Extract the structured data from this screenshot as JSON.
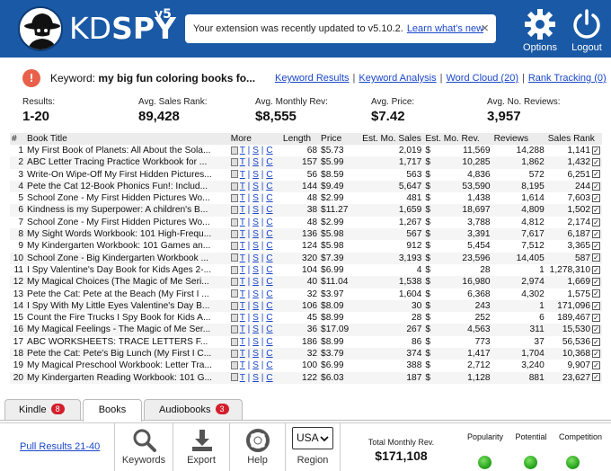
{
  "header": {
    "logo_main": "KD",
    "logo_spy": "SPY",
    "version": "v5",
    "notice_text": "Your extension was recently updated to v5.10.2.",
    "notice_link": "Learn what's new",
    "close_glyph": "×",
    "options_label": "Options",
    "logout_label": "Logout"
  },
  "keyword_bar": {
    "info_glyph": "!",
    "label": "Keyword:",
    "value": "my big fun coloring books fo...",
    "links": [
      "Keyword Results",
      "Keyword Analysis",
      "Word Cloud (20)",
      "Rank Tracking (0)"
    ],
    "separator": "|"
  },
  "stats": [
    {
      "label": "Results:",
      "value": "1-20"
    },
    {
      "label": "Avg. Sales Rank:",
      "value": "89,428"
    },
    {
      "label": "Avg. Monthly Rev:",
      "value": "$8,555"
    },
    {
      "label": "Avg. Price:",
      "value": "$7.42"
    },
    {
      "label": "Avg. No. Reviews:",
      "value": "3,957"
    }
  ],
  "table": {
    "headers": [
      "#",
      "Book Title",
      "More",
      "Length",
      "Price",
      "Est. Mo. Sales",
      "Est. Mo. Rev.",
      "Reviews",
      "Sales Rank"
    ],
    "more_links": [
      "T",
      "S",
      "C"
    ],
    "more_sep": "|",
    "currency": "$",
    "rows": [
      {
        "n": "1",
        "title": "My First Book of Planets: All About the Sola...",
        "length": "68",
        "price": "$5.73",
        "sales": "2,019",
        "rev": "11,569",
        "reviews": "14,288",
        "rank": "1,141"
      },
      {
        "n": "2",
        "title": "ABC Letter Tracing Practice Workbook for ...",
        "length": "157",
        "price": "$5.99",
        "sales": "1,717",
        "rev": "10,285",
        "reviews": "1,862",
        "rank": "1,432"
      },
      {
        "n": "3",
        "title": "Write-On Wipe-Off My First Hidden Pictures...",
        "length": "56",
        "price": "$8.59",
        "sales": "563",
        "rev": "4,836",
        "reviews": "572",
        "rank": "6,251"
      },
      {
        "n": "4",
        "title": "Pete the Cat 12-Book Phonics Fun!: Includ...",
        "length": "144",
        "price": "$9.49",
        "sales": "5,647",
        "rev": "53,590",
        "reviews": "8,195",
        "rank": "244"
      },
      {
        "n": "5",
        "title": "School Zone - My First Hidden Pictures Wo...",
        "length": "48",
        "price": "$2.99",
        "sales": "481",
        "rev": "1,438",
        "reviews": "1,614",
        "rank": "7,603"
      },
      {
        "n": "6",
        "title": "Kindness is my Superpower: A children's B...",
        "length": "38",
        "price": "$11.27",
        "sales": "1,659",
        "rev": "18,697",
        "reviews": "4,809",
        "rank": "1,502"
      },
      {
        "n": "7",
        "title": "School Zone - My First Hidden Pictures Wo...",
        "length": "48",
        "price": "$2.99",
        "sales": "1,267",
        "rev": "3,788",
        "reviews": "4,812",
        "rank": "2,174"
      },
      {
        "n": "8",
        "title": "My Sight Words Workbook: 101 High-Frequ...",
        "length": "136",
        "price": "$5.98",
        "sales": "567",
        "rev": "3,391",
        "reviews": "7,617",
        "rank": "6,187"
      },
      {
        "n": "9",
        "title": "My Kindergarten Workbook: 101 Games an...",
        "length": "124",
        "price": "$5.98",
        "sales": "912",
        "rev": "5,454",
        "reviews": "7,512",
        "rank": "3,365"
      },
      {
        "n": "10",
        "title": "School Zone - Big Kindergarten Workbook ...",
        "length": "320",
        "price": "$7.39",
        "sales": "3,193",
        "rev": "23,596",
        "reviews": "14,405",
        "rank": "587"
      },
      {
        "n": "11",
        "title": "I Spy Valentine's Day Book for Kids Ages 2-...",
        "length": "104",
        "price": "$6.99",
        "sales": "4",
        "rev": "28",
        "reviews": "1",
        "rank": "1,278,310"
      },
      {
        "n": "12",
        "title": "My Magical Choices (The Magic of Me Seri...",
        "length": "40",
        "price": "$11.04",
        "sales": "1,538",
        "rev": "16,980",
        "reviews": "2,974",
        "rank": "1,669"
      },
      {
        "n": "13",
        "title": "Pete the Cat: Pete at the Beach (My First I ...",
        "length": "32",
        "price": "$3.97",
        "sales": "1,604",
        "rev": "6,368",
        "reviews": "4,302",
        "rank": "1,575"
      },
      {
        "n": "14",
        "title": "I Spy With My Little Eyes Valentine's Day B...",
        "length": "106",
        "price": "$8.09",
        "sales": "30",
        "rev": "243",
        "reviews": "1",
        "rank": "171,096"
      },
      {
        "n": "15",
        "title": "Count the Fire Trucks I Spy Book for Kids A...",
        "length": "45",
        "price": "$8.99",
        "sales": "28",
        "rev": "252",
        "reviews": "6",
        "rank": "189,467"
      },
      {
        "n": "16",
        "title": "My Magical Feelings - The Magic of Me Ser...",
        "length": "36",
        "price": "$17.09",
        "sales": "267",
        "rev": "4,563",
        "reviews": "311",
        "rank": "15,530"
      },
      {
        "n": "17",
        "title": "ABC WORKSHEETS: TRACE LETTERS F...",
        "length": "186",
        "price": "$8.99",
        "sales": "86",
        "rev": "773",
        "reviews": "37",
        "rank": "56,536"
      },
      {
        "n": "18",
        "title": "Pete the Cat: Pete's Big Lunch (My First I C...",
        "length": "32",
        "price": "$3.79",
        "sales": "374",
        "rev": "1,417",
        "reviews": "1,704",
        "rank": "10,368"
      },
      {
        "n": "19",
        "title": "My Magical Preschool Workbook: Letter Tra...",
        "length": "100",
        "price": "$6.99",
        "sales": "388",
        "rev": "2,712",
        "reviews": "3,240",
        "rank": "9,907"
      },
      {
        "n": "20",
        "title": "My Kindergarten Reading Workbook: 101 G...",
        "length": "122",
        "price": "$6.03",
        "sales": "187",
        "rev": "1,128",
        "reviews": "881",
        "rank": "23,627"
      }
    ]
  },
  "tabs": [
    {
      "label": "Kindle",
      "badge": "8"
    },
    {
      "label": "Books",
      "badge": ""
    },
    {
      "label": "Audiobooks",
      "badge": "3"
    }
  ],
  "footer": {
    "pull_link": "Pull Results 21-40",
    "keywords_label": "Keywords",
    "export_label": "Export",
    "help_label": "Help",
    "region_value": "USA",
    "region_label": "Region",
    "total_label": "Total Monthly Rev.",
    "total_value": "$171,108",
    "indicators": [
      "Popularity",
      "Potential",
      "Competition"
    ],
    "indicator_color": "#2aa81e"
  }
}
